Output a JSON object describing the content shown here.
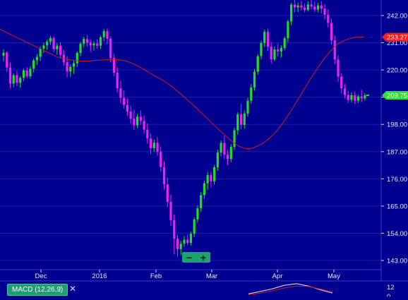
{
  "chart_data": {
    "type": "candlestick",
    "ylim": [
      140,
      248
    ],
    "y_ticks": [
      "242.00",
      "231.00",
      "220.00",
      "209.00",
      "198.00",
      "187.00",
      "176.00",
      "165.00",
      "154.00",
      "143.00"
    ],
    "x_ticks": [
      "Dec",
      "2016",
      "Feb",
      "Mar",
      "Apr",
      "May"
    ],
    "price_labels": [
      {
        "value": 233.27,
        "color": "#ff1a1a",
        "text": "233.27"
      },
      {
        "value": 209.75,
        "color": "#2fe02f",
        "text": "209.75"
      }
    ],
    "candles": [
      [
        225.8,
        228.4,
        223.5,
        227.0
      ],
      [
        227.0,
        227.5,
        219.2,
        221.0
      ],
      [
        221.0,
        223.0,
        212.6,
        214.5
      ],
      [
        214.5,
        218.7,
        213.0,
        217.9
      ],
      [
        217.9,
        219.6,
        213.5,
        214.8
      ],
      [
        214.8,
        217.5,
        212.9,
        216.8
      ],
      [
        216.8,
        220.6,
        215.5,
        219.8
      ],
      [
        219.8,
        221.2,
        216.8,
        217.5
      ],
      [
        217.5,
        221.5,
        216.5,
        220.5
      ],
      [
        220.5,
        224.7,
        219.0,
        223.9
      ],
      [
        223.9,
        226.4,
        222.0,
        225.3
      ],
      [
        225.3,
        229.4,
        223.6,
        228.6
      ],
      [
        228.6,
        230.9,
        226.9,
        229.9
      ],
      [
        229.9,
        232.2,
        228.1,
        231.4
      ],
      [
        231.4,
        233.8,
        230.1,
        232.9
      ],
      [
        232.9,
        233.5,
        227.2,
        228.4
      ],
      [
        228.4,
        230.9,
        226.2,
        229.8
      ],
      [
        229.8,
        231.2,
        224.8,
        226.1
      ],
      [
        226.1,
        228.1,
        221.7,
        223.1
      ],
      [
        223.1,
        225.6,
        217.1,
        219.4
      ],
      [
        219.4,
        222.2,
        217.2,
        221.3
      ],
      [
        221.3,
        223.9,
        218.4,
        222.7
      ],
      [
        222.7,
        227.5,
        221.2,
        226.9
      ],
      [
        226.9,
        231.4,
        225.6,
        230.6
      ],
      [
        230.6,
        233.4,
        229.1,
        232.5
      ],
      [
        232.5,
        234.1,
        229.4,
        231.0
      ],
      [
        231.0,
        232.1,
        227.3,
        229.9
      ],
      [
        229.9,
        231.6,
        227.8,
        230.7
      ],
      [
        230.7,
        232.3,
        228.6,
        229.8
      ],
      [
        229.8,
        233.9,
        228.5,
        233.2
      ],
      [
        233.2,
        236.6,
        231.6,
        235.7
      ],
      [
        235.7,
        236.7,
        230.3,
        232.6
      ],
      [
        232.6,
        233.6,
        223.1,
        224.8
      ],
      [
        224.8,
        226.5,
        217.4,
        218.9
      ],
      [
        218.9,
        221.2,
        210.8,
        212.6
      ],
      [
        212.6,
        215.7,
        206.6,
        208.7
      ],
      [
        208.7,
        211.7,
        204.4,
        205.9
      ],
      [
        205.9,
        208.5,
        201.5,
        203.2
      ],
      [
        203.2,
        205.6,
        198.3,
        200.3
      ],
      [
        200.3,
        203.9,
        195.8,
        197.6
      ],
      [
        197.6,
        202.2,
        196.5,
        201.1
      ],
      [
        201.1,
        203.6,
        197.8,
        199.4
      ],
      [
        199.4,
        201.6,
        194.4,
        195.9
      ],
      [
        195.9,
        198.3,
        190.3,
        192.3
      ],
      [
        192.3,
        194.3,
        186.0,
        188.4
      ],
      [
        188.4,
        191.8,
        187.0,
        190.6
      ],
      [
        190.6,
        192.8,
        185.3,
        186.9
      ],
      [
        186.9,
        189.0,
        178.9,
        180.8
      ],
      [
        180.8,
        183.1,
        171.6,
        173.8
      ],
      [
        173.8,
        176.5,
        164.5,
        166.7
      ],
      [
        166.7,
        169.6,
        157.1,
        159.3
      ],
      [
        159.3,
        161.7,
        145.5,
        151.8
      ],
      [
        151.8,
        153.3,
        144.6,
        147.6
      ],
      [
        147.6,
        151.0,
        145.2,
        149.8
      ],
      [
        149.8,
        152.8,
        148.5,
        151.4
      ],
      [
        151.4,
        153.4,
        149.2,
        150.1
      ],
      [
        150.1,
        154.6,
        149.1,
        153.8
      ],
      [
        153.8,
        160.4,
        152.4,
        159.6
      ],
      [
        159.6,
        165.3,
        158.3,
        164.1
      ],
      [
        164.1,
        170.6,
        162.6,
        169.4
      ],
      [
        169.4,
        175.3,
        167.9,
        174.2
      ],
      [
        174.2,
        178.8,
        171.6,
        177.5
      ],
      [
        177.5,
        178.9,
        172.5,
        175.0
      ],
      [
        175.0,
        181.6,
        173.6,
        180.7
      ],
      [
        180.7,
        187.7,
        179.3,
        186.6
      ],
      [
        186.6,
        191.5,
        185.1,
        190.5
      ],
      [
        190.5,
        193.4,
        184.0,
        185.8
      ],
      [
        185.8,
        187.6,
        181.6,
        184.0
      ],
      [
        184.0,
        190.1,
        182.7,
        188.9
      ],
      [
        188.9,
        196.7,
        187.6,
        195.6
      ],
      [
        195.6,
        202.9,
        193.9,
        202.1
      ],
      [
        202.1,
        206.3,
        196.0,
        197.8
      ],
      [
        197.8,
        203.6,
        196.3,
        202.4
      ],
      [
        202.4,
        208.8,
        201.1,
        207.6
      ],
      [
        207.6,
        214.3,
        206.3,
        212.9
      ],
      [
        212.9,
        220.4,
        211.6,
        219.3
      ],
      [
        219.3,
        226.5,
        218.1,
        225.6
      ],
      [
        225.6,
        231.8,
        224.4,
        230.9
      ],
      [
        230.9,
        236.3,
        229.4,
        235.4
      ],
      [
        235.4,
        236.7,
        227.6,
        229.4
      ],
      [
        229.4,
        231.2,
        222.7,
        224.3
      ],
      [
        224.3,
        229.4,
        223.6,
        228.3
      ],
      [
        228.3,
        230.6,
        225.6,
        227.5
      ],
      [
        227.5,
        229.9,
        225.1,
        228.9
      ],
      [
        228.9,
        233.6,
        227.9,
        232.8
      ],
      [
        232.8,
        240.3,
        231.2,
        239.6
      ],
      [
        239.6,
        247.1,
        238.1,
        246.4
      ],
      [
        246.4,
        248.6,
        243.2,
        245.3
      ],
      [
        245.3,
        247.2,
        243.4,
        246.1
      ],
      [
        246.1,
        247.9,
        244.1,
        245.2
      ],
      [
        245.2,
        246.8,
        243.3,
        244.3
      ],
      [
        244.3,
        247.8,
        243.6,
        246.5
      ],
      [
        246.5,
        248.3,
        244.6,
        245.6
      ],
      [
        245.6,
        247.7,
        243.4,
        244.4
      ],
      [
        244.4,
        247.2,
        243.3,
        246.1
      ],
      [
        246.1,
        247.8,
        242.9,
        244.8
      ],
      [
        244.8,
        246.6,
        240.4,
        242.3
      ],
      [
        242.3,
        244.5,
        237.2,
        239.0
      ],
      [
        239.0,
        240.6,
        230.3,
        232.0
      ],
      [
        232.0,
        233.9,
        222.3,
        224.2
      ],
      [
        224.2,
        225.9,
        215.3,
        217.3
      ],
      [
        217.3,
        218.7,
        210.6,
        212.6
      ],
      [
        212.6,
        214.3,
        208.5,
        209.9
      ],
      [
        209.9,
        211.6,
        206.6,
        207.9
      ],
      [
        207.9,
        210.9,
        206.9,
        209.8
      ],
      [
        209.8,
        211.2,
        206.3,
        207.6
      ],
      [
        207.6,
        210.1,
        206.6,
        209.3
      ],
      [
        209.3,
        212.1,
        207.0,
        208.5
      ],
      [
        208.5,
        210.6,
        207.6,
        209.75
      ]
    ],
    "moving_average": {
      "color": "#d01c1c",
      "values": [
        236.4,
        235.7,
        235.0,
        234.3,
        233.6,
        232.9,
        232.2,
        231.5,
        230.8,
        230.1,
        229.4,
        228.7,
        228.0,
        227.3,
        226.6,
        225.9,
        225.2,
        224.8,
        224.5,
        224.2,
        224.0,
        223.8,
        223.6,
        223.5,
        223.5,
        223.6,
        223.8,
        223.9,
        224.0,
        224.1,
        224.2,
        224.2,
        224.2,
        224.1,
        224.0,
        223.6,
        223.1,
        222.5,
        221.8,
        221.0,
        220.2,
        219.3,
        218.4,
        217.6,
        216.8,
        216.0,
        215.1,
        214.1,
        213.0,
        211.8,
        210.6,
        209.3,
        208.0,
        206.7,
        205.4,
        204.0,
        202.6,
        201.2,
        199.8,
        198.4,
        197.0,
        195.6,
        194.3,
        193.0,
        191.7,
        190.5,
        189.5,
        188.8,
        188.3,
        188.2,
        188.4,
        188.9,
        189.6,
        190.4,
        191.4,
        192.6,
        194.0,
        195.6,
        197.4,
        199.4,
        201.6,
        203.8,
        206.2,
        208.6,
        211.0,
        213.4,
        215.8,
        218.0,
        220.2,
        222.4,
        224.4,
        226.2,
        227.9,
        229.4,
        230.6,
        231.5,
        232.1,
        232.6,
        233.0,
        233.2,
        233.3,
        233.27
      ]
    },
    "colors": {
      "up": "#22dd22",
      "down": "#ee22ee",
      "background": "#000090",
      "grid": "#1e1ea8"
    }
  },
  "macd": {
    "label": "MACD (12,26,9)",
    "up_symbol": "↑",
    "close_symbol": "✕",
    "tick_labels": [
      "12",
      "0"
    ],
    "macd_line_color": "#e8e8ff",
    "signal_line_color": "#d01c1c",
    "macd_values": [
      -2.0,
      1.0,
      4.5,
      9.0,
      11.0,
      8.0,
      3.0,
      -1.0
    ],
    "signal_values": [
      -3.0,
      -1.0,
      2.0,
      5.5,
      8.0,
      7.5,
      4.0,
      0.5
    ]
  },
  "zoom": {
    "minus": "−",
    "plus": "+"
  }
}
